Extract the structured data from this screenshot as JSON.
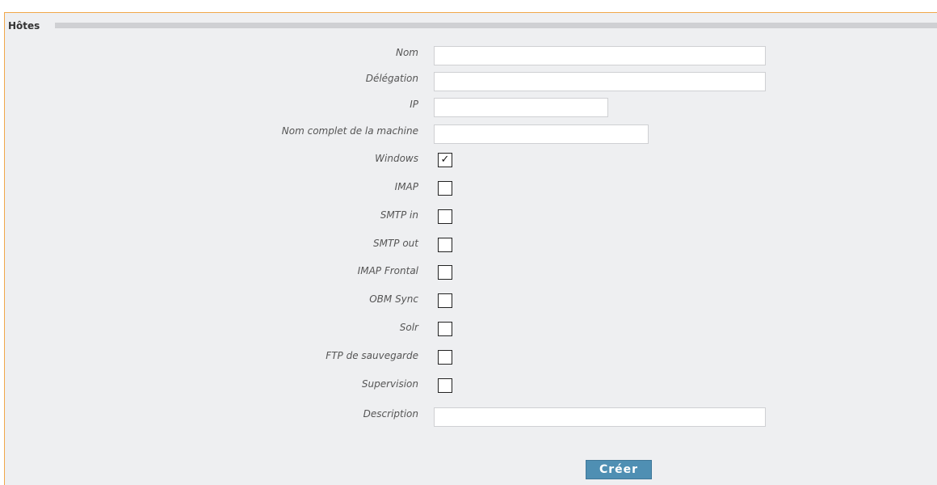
{
  "section": {
    "title": "Hôtes"
  },
  "fields": {
    "nom": {
      "label": "Nom",
      "value": ""
    },
    "delegation": {
      "label": "Délégation",
      "value": ""
    },
    "ip": {
      "label": "IP",
      "value": ""
    },
    "fqdn": {
      "label": "Nom complet de la machine",
      "value": ""
    },
    "description": {
      "label": "Description",
      "value": ""
    }
  },
  "services": [
    {
      "label": "Windows",
      "checked": true,
      "mark": "✓"
    },
    {
      "label": "IMAP",
      "checked": false,
      "mark": ""
    },
    {
      "label": "SMTP in",
      "checked": false,
      "mark": ""
    },
    {
      "label": "SMTP out",
      "checked": false,
      "mark": ""
    },
    {
      "label": "IMAP Frontal",
      "checked": false,
      "mark": ""
    },
    {
      "label": "OBM Sync",
      "checked": false,
      "mark": ""
    },
    {
      "label": "Solr",
      "checked": false,
      "mark": ""
    },
    {
      "label": "FTP de sauvegarde",
      "checked": false,
      "mark": ""
    },
    {
      "label": "Supervision",
      "checked": false,
      "mark": ""
    }
  ],
  "actions": {
    "submit_label": "Créer"
  },
  "colors": {
    "accent_border": "#f0a84a",
    "button": "#4f8fb3",
    "panel_bg": "#eeeff1"
  }
}
